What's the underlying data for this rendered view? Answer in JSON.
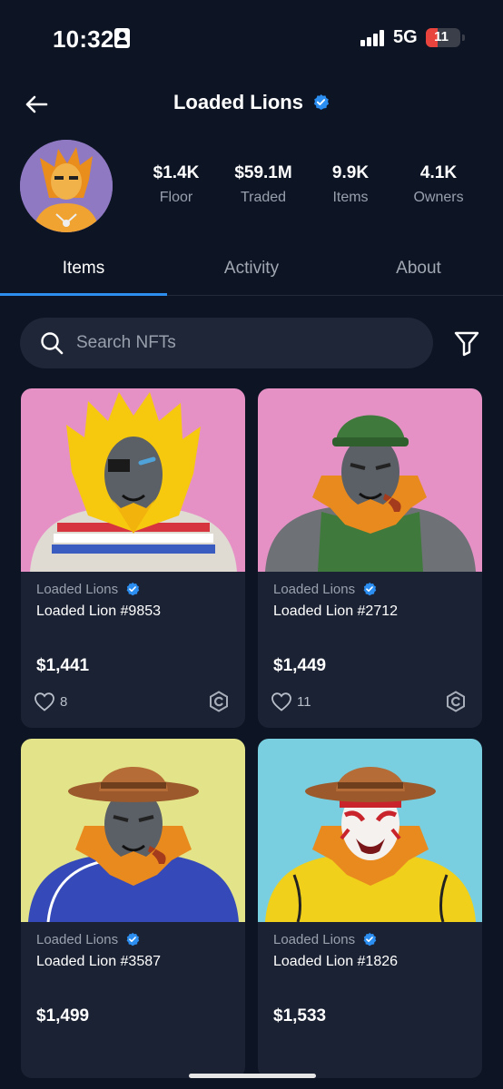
{
  "status_bar": {
    "time": "10:32",
    "network": "5G",
    "battery_level": "11",
    "battery_fraction": 0.11
  },
  "header": {
    "title": "Loaded Lions",
    "back_icon": "arrow-left-icon",
    "verified_icon": "verified-badge-icon"
  },
  "collection": {
    "stats": [
      {
        "value": "$1.4K",
        "label": "Floor"
      },
      {
        "value": "$59.1M",
        "label": "Traded"
      },
      {
        "value": "9.9K",
        "label": "Items"
      },
      {
        "value": "4.1K",
        "label": "Owners"
      }
    ]
  },
  "tabs": [
    {
      "label": "Items",
      "active": true
    },
    {
      "label": "Activity",
      "active": false
    },
    {
      "label": "About",
      "active": false
    }
  ],
  "search": {
    "placeholder": "Search NFTs",
    "value": ""
  },
  "filter_icon": "filter-funnel-icon",
  "items": [
    {
      "collection": "Loaded Lions",
      "name": "Loaded Lion #9853",
      "price": "$1,441",
      "likes": "8",
      "background": "#e691c6"
    },
    {
      "collection": "Loaded Lions",
      "name": "Loaded Lion #2712",
      "price": "$1,449",
      "likes": "11",
      "background": "#e691c6"
    },
    {
      "collection": "Loaded Lions",
      "name": "Loaded Lion #3587",
      "price": "$1,499",
      "likes": "",
      "background": "#e3e489"
    },
    {
      "collection": "Loaded Lions",
      "name": "Loaded Lion #1826",
      "price": "$1,533",
      "likes": "",
      "background": "#79cfe0"
    }
  ],
  "colors": {
    "background": "#0d1423",
    "card": "#1b2233",
    "accent": "#2e8ef0",
    "verified": "#2b8ef0"
  }
}
